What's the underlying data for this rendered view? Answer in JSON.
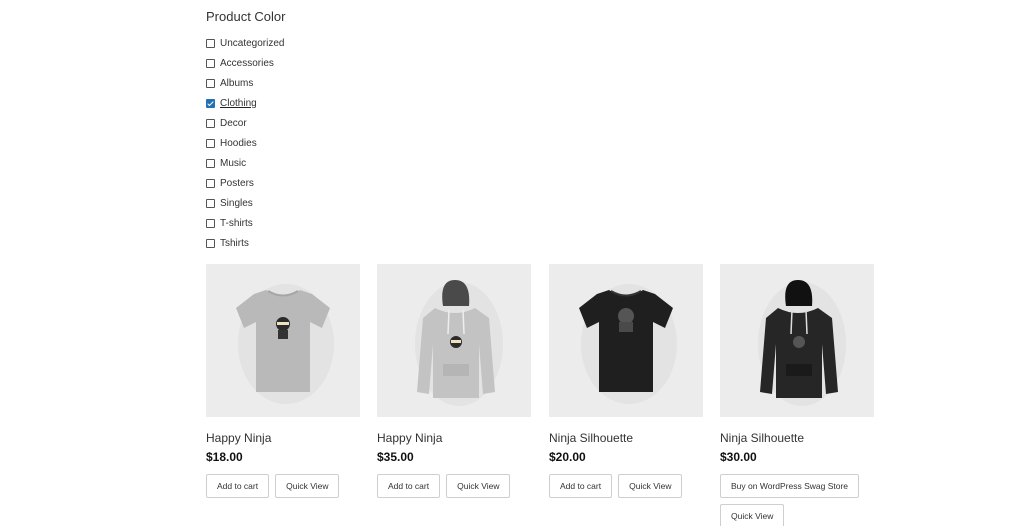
{
  "filter": {
    "title": "Product Color",
    "items": [
      {
        "label": "Uncategorized",
        "checked": false
      },
      {
        "label": "Accessories",
        "checked": false
      },
      {
        "label": "Albums",
        "checked": false
      },
      {
        "label": "Clothing",
        "checked": true
      },
      {
        "label": "Decor",
        "checked": false
      },
      {
        "label": "Hoodies",
        "checked": false
      },
      {
        "label": "Music",
        "checked": false
      },
      {
        "label": "Posters",
        "checked": false
      },
      {
        "label": "Singles",
        "checked": false
      },
      {
        "label": "T-shirts",
        "checked": false
      },
      {
        "label": "Tshirts",
        "checked": false
      }
    ]
  },
  "products": [
    {
      "title": "Happy Ninja",
      "price": "$18.00",
      "image": "grey-tshirt-ninja",
      "buttons": [
        "Add to cart",
        "Quick View"
      ]
    },
    {
      "title": "Happy Ninja",
      "price": "$35.00",
      "image": "grey-hoodie-ninja",
      "buttons": [
        "Add to cart",
        "Quick View"
      ]
    },
    {
      "title": "Ninja Silhouette",
      "price": "$20.00",
      "image": "black-tshirt-ninja",
      "buttons": [
        "Add to cart",
        "Quick View"
      ]
    },
    {
      "title": "Ninja Silhouette",
      "price": "$30.00",
      "image": "black-hoodie-ninja",
      "buttons": [
        "Buy on WordPress Swag Store",
        "Quick View"
      ]
    }
  ],
  "colors": {
    "accent": "#2271b1",
    "image_bg": "#ececec"
  }
}
